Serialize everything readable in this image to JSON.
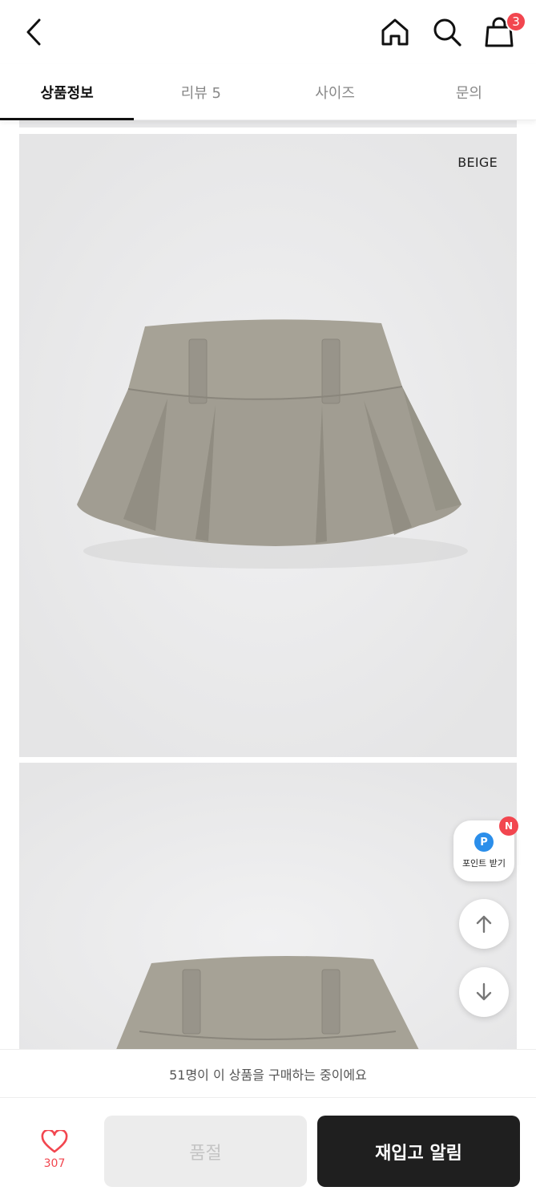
{
  "header": {
    "cart_count": "3"
  },
  "tabs": [
    {
      "label": "상품정보",
      "active": true
    },
    {
      "label": "리뷰 5",
      "active": false
    },
    {
      "label": "사이즈",
      "active": false
    },
    {
      "label": "문의",
      "active": false
    }
  ],
  "product": {
    "color_label": "BEIGE",
    "skirt_color": "#a19d92"
  },
  "floating": {
    "point_icon_letter": "P",
    "point_label": "포인트 받기",
    "new_badge": "N"
  },
  "notice": "51명이 이 상품을 구매하는 중이에요",
  "bottom": {
    "wish_count": "307",
    "soldout_label": "품절",
    "restock_label": "재입고 알림"
  },
  "colors": {
    "accent": "#f2464f",
    "dark_button": "#1f1f1f",
    "point_blue": "#2b8eea"
  }
}
